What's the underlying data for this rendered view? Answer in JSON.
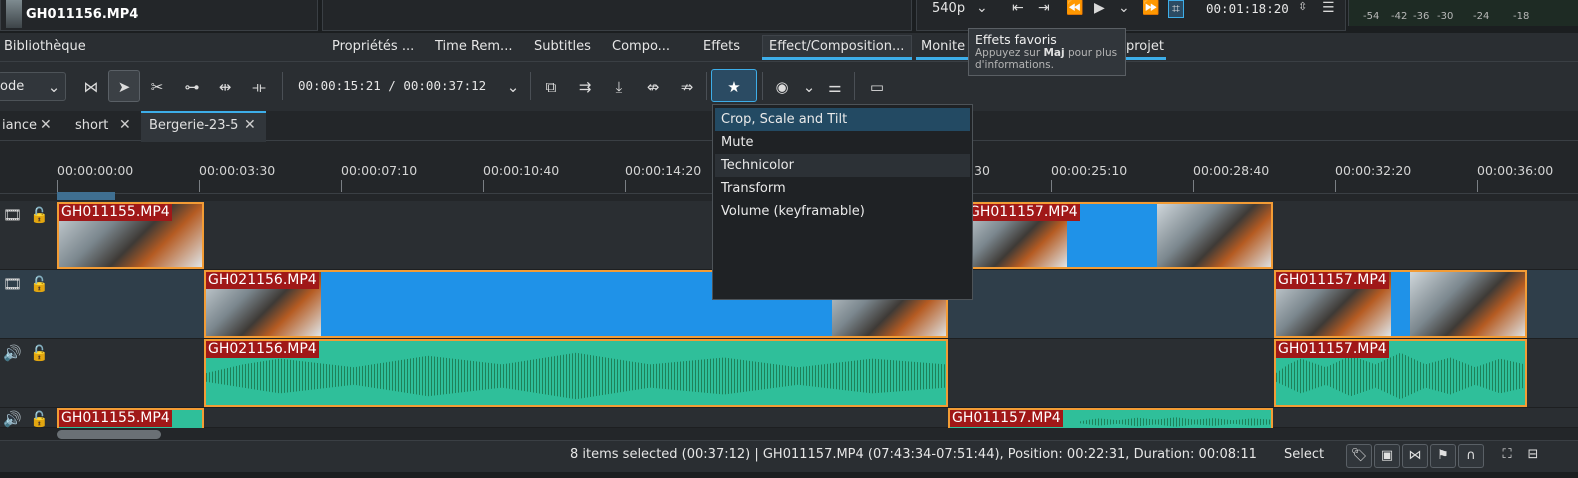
{
  "top": {
    "clip_name": "GH011156.MP4",
    "resolution": "540p",
    "monitor_time": "00:01:18:20",
    "db_scale": [
      "-54",
      "-42",
      "-36",
      "-30",
      "-24",
      "-18"
    ]
  },
  "tabs": {
    "library": "Bibliothèque",
    "properties": "Propriétés ...",
    "time_remap": "Time Rem...",
    "subtitles": "Subtitles",
    "compositions": "Compo...",
    "effects": "Effets",
    "effect_composition": "Effect/Composition...",
    "monitor": "Monite",
    "project": "projet"
  },
  "tooltip": {
    "title": "Effets favoris",
    "line1": "Appuyez sur ",
    "key": "Maj",
    "line2": " pour plus",
    "line3": "d'informations."
  },
  "toolbar": {
    "mode_label": "ode",
    "timecode": "00:00:15:21 / 00:00:37:12"
  },
  "sequence_tabs": [
    {
      "label": "iance"
    },
    {
      "label": "short"
    },
    {
      "label": "Bergerie-23-5"
    }
  ],
  "ruler": [
    "00:00:00:00",
    "00:00:03:30",
    "00:00:07:10",
    "00:00:10:40",
    "00:00:14:20",
    "30",
    "00:00:25:10",
    "00:00:28:40",
    "00:00:32:20",
    "00:00:36:00"
  ],
  "favorites_menu": [
    "Crop, Scale and Tilt",
    "Mute",
    "Technicolor",
    "Transform",
    "Volume (keyframable)"
  ],
  "clips": {
    "v2_a": "GH011155.MP4",
    "v2_b": "GH011157.MP4",
    "v1_a": "GH021156.MP4",
    "v1_b": "GH011157.MP4",
    "a1_a": "GH021156.MP4",
    "a1_b": "GH011157.MP4",
    "a2_a": "GH011155.MP4",
    "a2_b": "GH011157.MP4"
  },
  "status": {
    "text": "8 items selected (00:37:12) |  GH011157.MP4 (07:43:34-07:51:44), Position: 00:22:31, Duration: 00:08:11",
    "mode": "Select"
  },
  "colors": {
    "accent": "#3daee9",
    "clip_border": "#f39c35",
    "clip_label_bg": "#a01818",
    "video_clip": "#1f92e8",
    "audio_clip": "#2fbf9a"
  }
}
